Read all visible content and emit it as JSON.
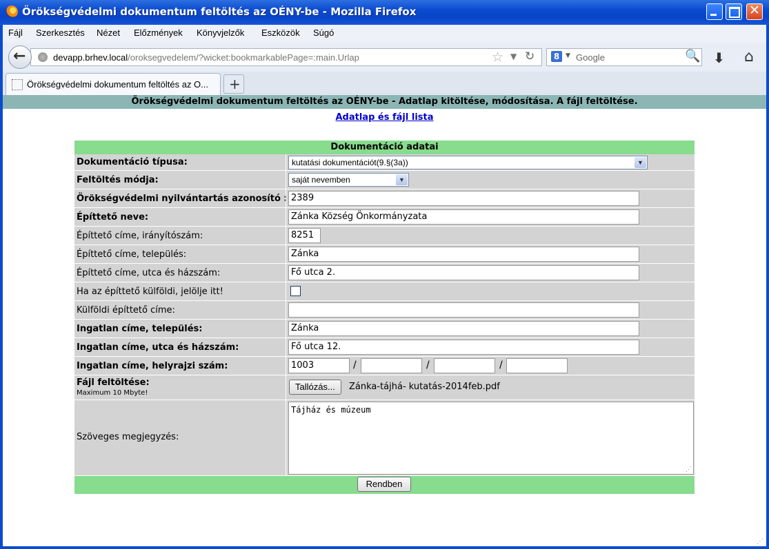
{
  "window": {
    "title": "Örökségvédelmi dokumentum feltöltés az OÉNY-be - Mozilla Firefox"
  },
  "menu": [
    "Fájl",
    "Szerkesztés",
    "Nézet",
    "Előzmények",
    "Könyvjelzők",
    "Eszközök",
    "Súgó"
  ],
  "nav": {
    "url_host": "devapp.brhev.local",
    "url_path": "/oroksegvedelem/?wicket:bookmarkablePage=:main.Urlap",
    "search_placeholder": "Google"
  },
  "tab": {
    "title": "Örökségvédelmi dokumentum feltöltés az O...",
    "new_tab": "+"
  },
  "page": {
    "header": "Örökségvédelmi dokumentum feltöltés az OÉNY-be - Adatlap kitöltése, módosítása. A fájl feltöltése.",
    "top_link": "Adatlap és fájl lista",
    "form_title": "Dokumentáció adatai"
  },
  "form": {
    "doc_type": {
      "label": "Dokumentáció típusa:",
      "value": "kutatási dokumentációt(9.§(3a))"
    },
    "upload_mode": {
      "label": "Feltöltés módja:",
      "value": "saját nevemben"
    },
    "registry_id": {
      "label": "Örökségvédelmi nyilvántartás azonosító :",
      "value": "2389"
    },
    "builder_name": {
      "label": "Építtető neve:",
      "value": "Zánka Község Önkormányzata"
    },
    "builder_zip": {
      "label": "Építtető címe, irányítószám:",
      "value": "8251"
    },
    "builder_city": {
      "label": "Építtető címe, település:",
      "value": "Zánka"
    },
    "builder_street": {
      "label": "Építtető címe, utca és házszám:",
      "value": "Fő utca 2."
    },
    "foreign_check": {
      "label": "Ha az építtető külföldi, jelölje itt!"
    },
    "foreign_address": {
      "label": "Külföldi építtető címe:",
      "value": ""
    },
    "property_city": {
      "label": "Ingatlan címe, település:",
      "value": "Zánka"
    },
    "property_street": {
      "label": "Ingatlan címe, utca és házszám:",
      "value": "Fő utca 12."
    },
    "property_lot": {
      "label": "Ingatlan címe, helyrajzi szám:",
      "values": [
        "1003",
        "",
        "",
        ""
      ],
      "separator": "/"
    },
    "file_upload": {
      "label": "Fájl feltöltése:",
      "hint": "Maximum 10 Mbyte!",
      "button": "Tallózás...",
      "filename": "Zánka-tájhá- kutatás-2014feb.pdf"
    },
    "notes": {
      "label": "Szöveges megjegyzés:",
      "value": "Tájház és múzeum"
    },
    "submit": "Rendben"
  }
}
